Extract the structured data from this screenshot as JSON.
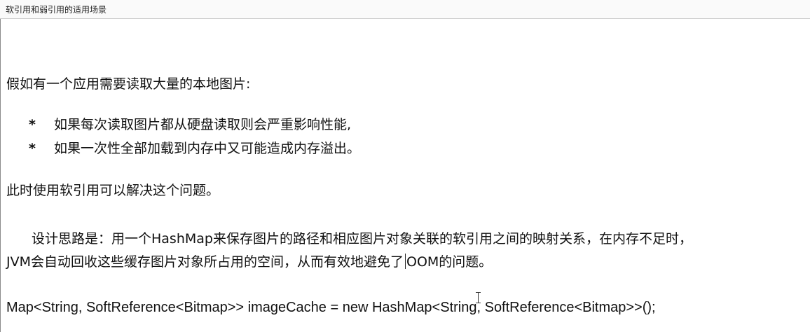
{
  "header": {
    "title": "软引用和弱引用的适用场景"
  },
  "document": {
    "intro": "假如有一个应用需要读取大量的本地图片:",
    "bullet_marker": "*",
    "bullets": [
      "如果每次读取图片都从硬盘读取则会严重影响性能,",
      "如果一次性全部加载到内存中又可能造成内存溢出。"
    ],
    "conclusion": "此时使用软引用可以解决这个问题。",
    "design_line1": "设计思路是：用一个HashMap来保存图片的路径和相应图片对象关联的软引用之间的映射关系，在内存不足时，",
    "design_line2_before_caret": "JVM会自动回收这些缓存图片对象所占用的空间，从而有效地避免了",
    "design_line2_after_caret": "OOM的问题。",
    "code_line": "Map<String, SoftReference<Bitmap>> imageCache = new HashMap<String, SoftReference<Bitmap>>();"
  }
}
